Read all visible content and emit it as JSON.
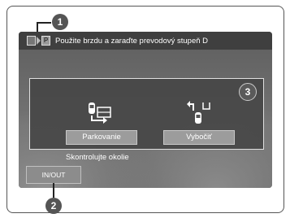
{
  "callouts": {
    "c1": "1",
    "c2": "2",
    "c3": "3"
  },
  "status_bar": {
    "gear_icon": "P",
    "message": "Použite brzdu a zaraďte prevodový stupeň D"
  },
  "options": [
    {
      "label": "Parkovanie",
      "icon": "parking-icon"
    },
    {
      "label": "Vybočiť",
      "icon": "exit-icon"
    }
  ],
  "hint": "Skontrolujte okolie",
  "inout_button": "IN/OUT",
  "colors": {
    "accent": "#555555",
    "panel": "#464646",
    "button": "#9c9c9c"
  }
}
